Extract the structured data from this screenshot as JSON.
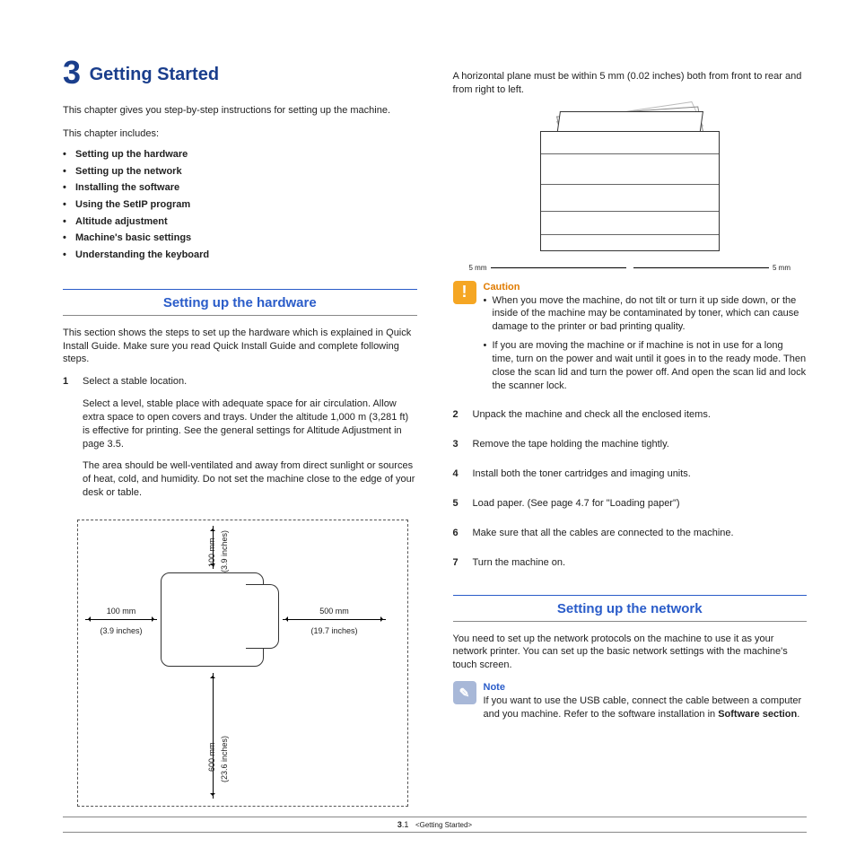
{
  "chapter": {
    "number": "3",
    "title": "Getting Started"
  },
  "intro": "This chapter gives you step-by-step instructions for setting up the machine.",
  "includes_label": "This chapter includes:",
  "toc": [
    "Setting up the hardware",
    "Setting up the network",
    "Installing the software",
    "Using the SetIP program",
    "Altitude adjustment",
    "Machine's basic settings",
    "Understanding the keyboard"
  ],
  "hw": {
    "heading": "Setting up the hardware",
    "intro": "This section shows the steps to set up the hardware which is explained in Quick Install Guide. Make sure you read Quick Install Guide and complete following steps.",
    "step1": {
      "num": "1",
      "title": "Select a stable location.",
      "p1": "Select a level, stable place with adequate space for air circulation. Allow extra space to open covers and trays. Under the altitude 1,000 m (3,281 ft) is effective for printing. See the general settings for Altitude Adjustment in page 3.5.",
      "p2": "The area should be well-ventilated and away from direct sunlight or sources of heat, cold, and humidity. Do not set the machine close to the edge of your desk or table."
    },
    "dims": {
      "left_mm": "100 mm",
      "left_in": "(3.9 inches)",
      "right_mm": "500 mm",
      "right_in": "(19.7 inches)",
      "top_mm": "100 mm",
      "top_in": "(3.9 inches)",
      "bottom_mm": "600 mm",
      "bottom_in": "(23.6 inches)"
    }
  },
  "right": {
    "plane_text": "A horizontal plane must be within 5 mm (0.02 inches) both from front to rear and from right to left.",
    "pf_dim_left": "5 mm",
    "pf_dim_right": "5 mm",
    "caution": {
      "title": "Caution",
      "b1": "When you move the machine, do not tilt or turn it up side down, or the inside of the machine may be contaminated by toner, which can cause damage to the printer or bad printing quality.",
      "b2": "If you are moving the machine or if machine is not in use for a long time, turn on the power and wait until it goes in to the ready mode. Then close the scan lid and turn the power off. And open the scan lid and lock the scanner lock."
    },
    "steps": [
      {
        "num": "2",
        "text": "Unpack the machine and check all the enclosed items."
      },
      {
        "num": "3",
        "text": "Remove the tape holding the machine tightly."
      },
      {
        "num": "4",
        "text": "Install both the toner cartridges and imaging units."
      },
      {
        "num": "5",
        "text": "Load paper. (See  page 4.7 for \"Loading paper\")"
      },
      {
        "num": "6",
        "text": "Make sure that all the cables are connected to the machine."
      },
      {
        "num": "7",
        "text": "Turn the machine on."
      }
    ],
    "net": {
      "heading": "Setting up the network",
      "intro": "You need to set up the network protocols on the machine to use it as your network printer. You can set up the basic network settings with the machine's touch screen.",
      "note_title": "Note",
      "note_text_1": "If you want to use the USB cable, connect the cable between a computer and you machine. Refer to the software installation in ",
      "note_bold": "Software section",
      "note_text_2": "."
    }
  },
  "footer": {
    "pg_chapter": "3",
    "pg_sep": ".",
    "pg_page": "1",
    "crumb": "<Getting Started>"
  }
}
